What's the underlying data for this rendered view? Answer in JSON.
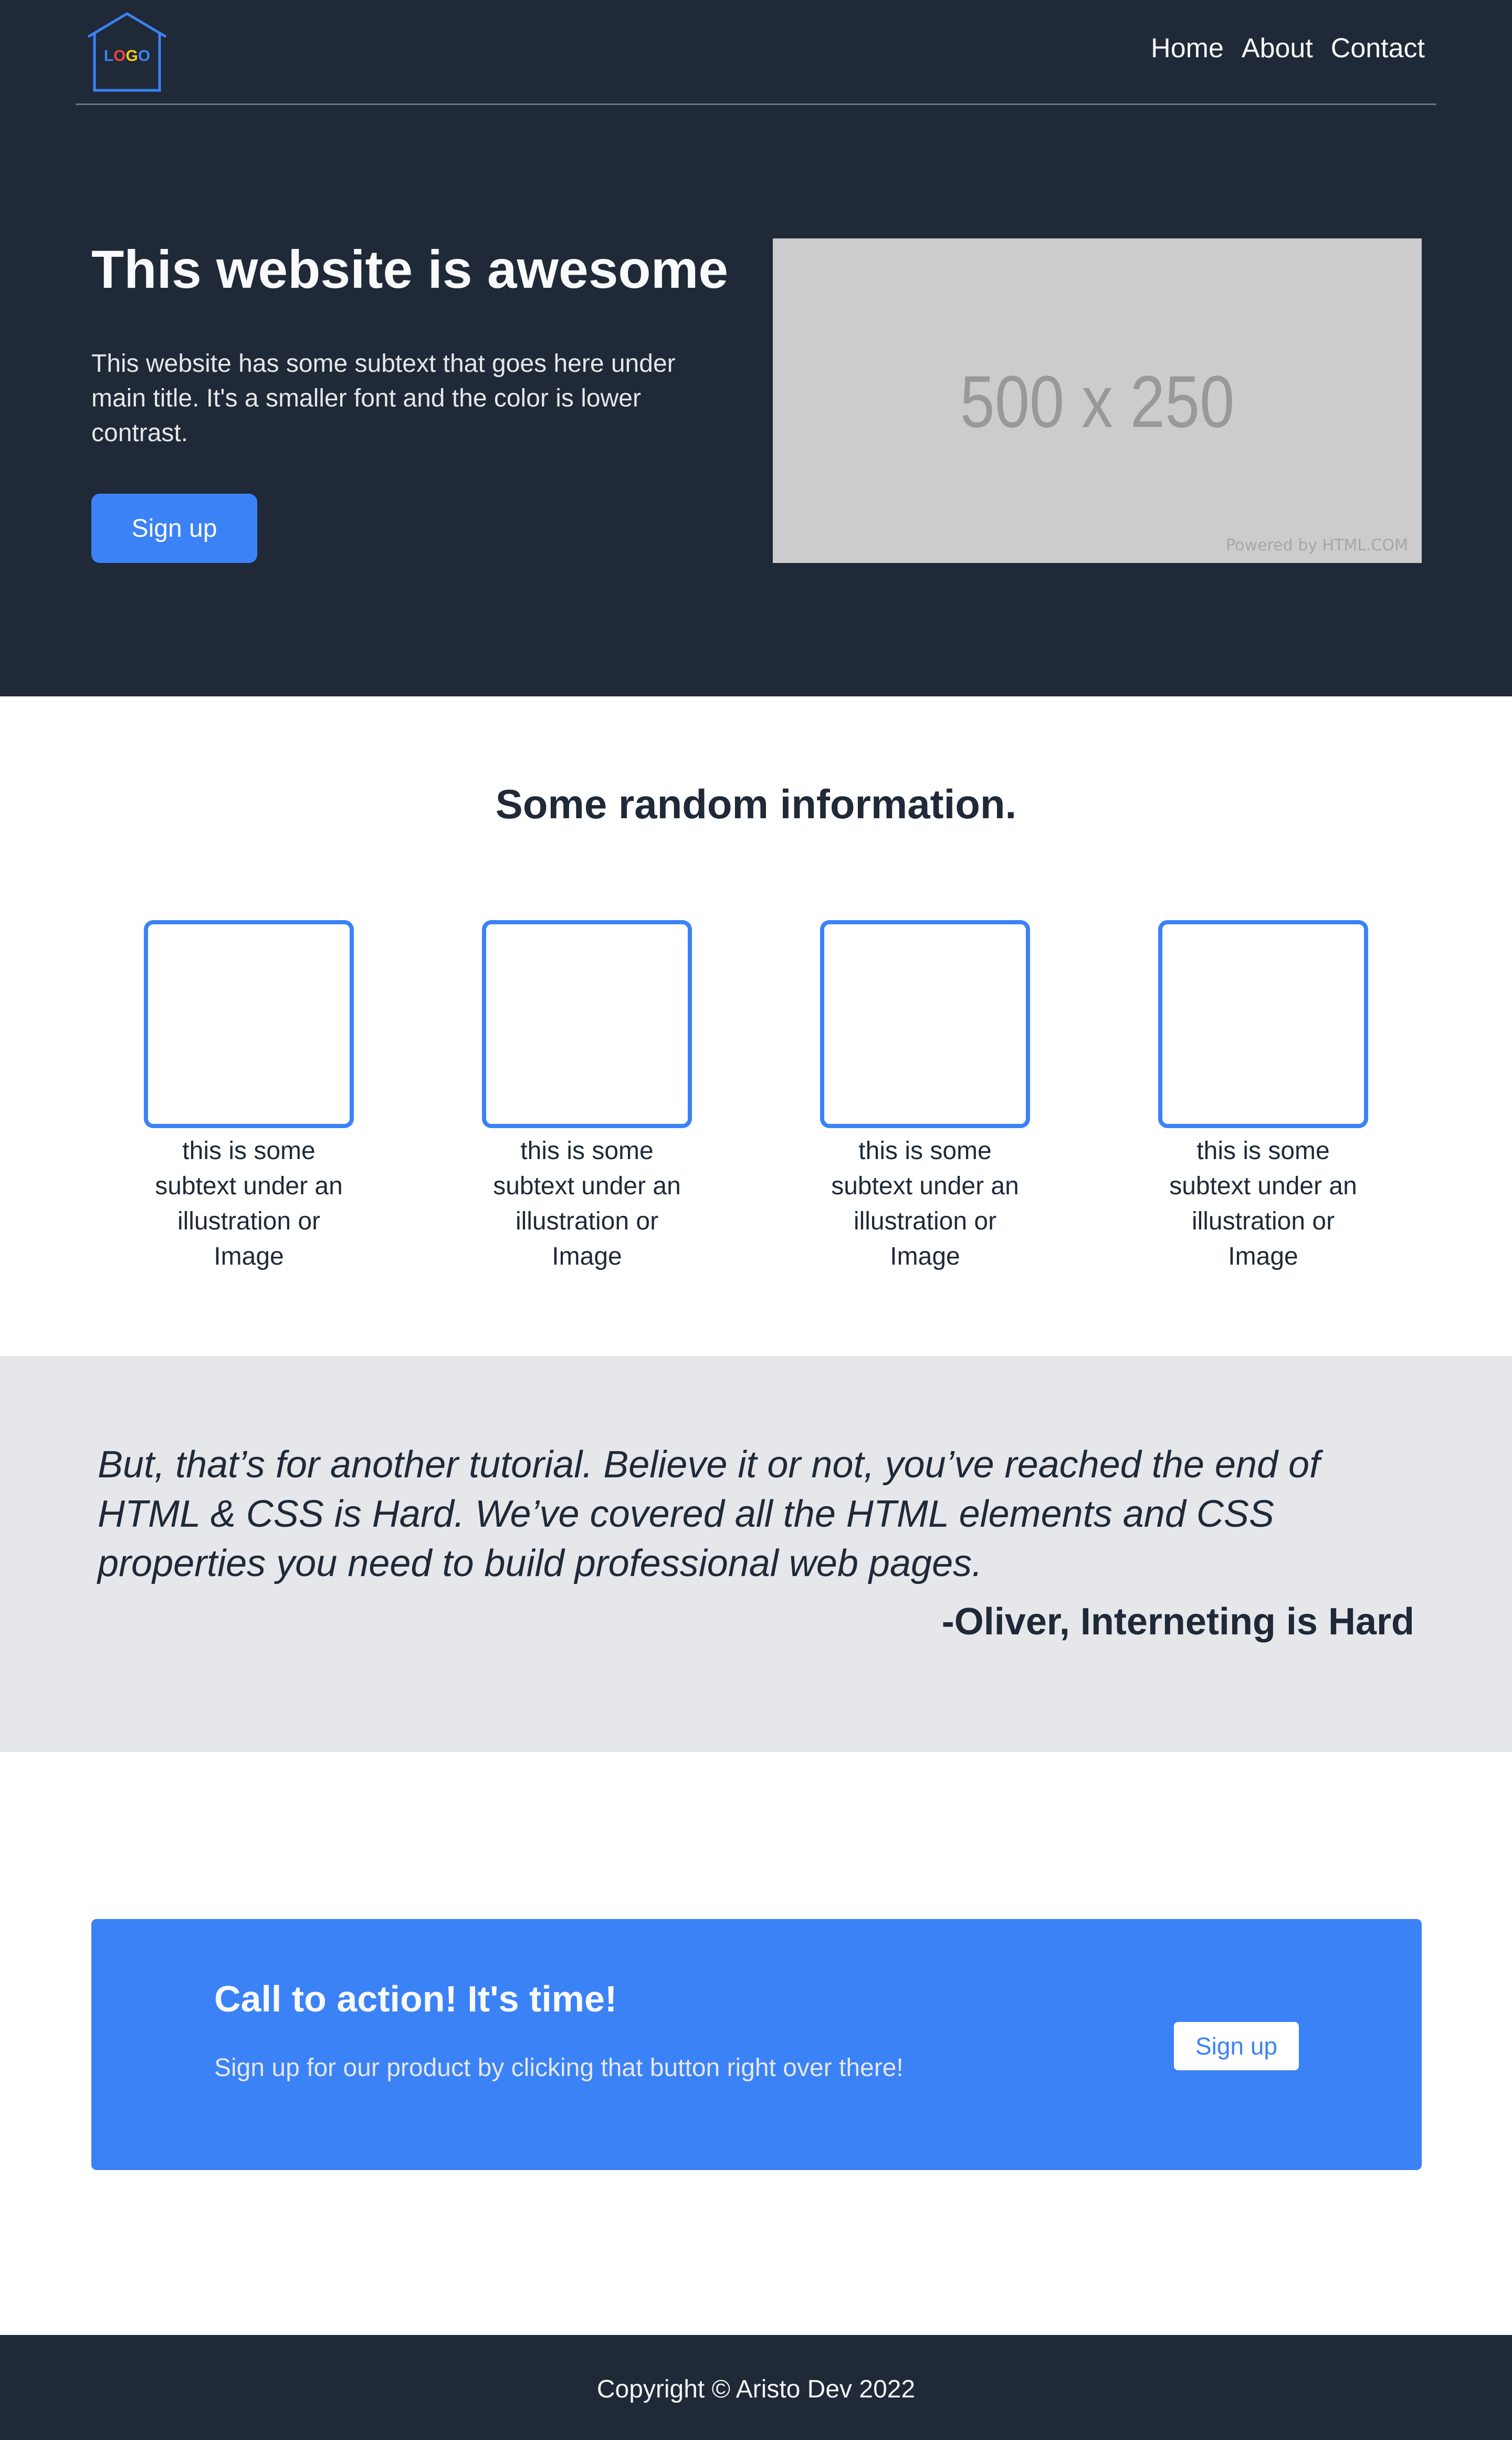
{
  "colors": {
    "dark": "#1f2937",
    "accent": "#3b82f6",
    "light_gray": "#e5e7eb",
    "white": "#ffffff",
    "placeholder": "#cccccc"
  },
  "header": {
    "logo": {
      "icon": "house-logo-icon",
      "letters": [
        "L",
        "O",
        "G",
        "O"
      ],
      "letter_colors": [
        "#3b82f6",
        "#ef4444",
        "#facc15",
        "#3b82f6"
      ]
    },
    "nav": [
      {
        "label": "Home"
      },
      {
        "label": "About"
      },
      {
        "label": "Contact"
      }
    ]
  },
  "hero": {
    "title": "This website is awesome",
    "subtext": "This website has some subtext that goes here under main title. It's a smaller font and the color is lower contrast.",
    "button_label": "Sign up",
    "image": {
      "label": "500 x 250",
      "powered_by": "Powered by HTML.COM"
    }
  },
  "info": {
    "heading": "Some random information.",
    "cards": [
      {
        "caption": "this is some subtext under an illustration or Image"
      },
      {
        "caption": "this is some subtext under an illustration or Image"
      },
      {
        "caption": "this is some subtext under an illustration or Image"
      },
      {
        "caption": "this is some subtext under an illustration or Image"
      }
    ]
  },
  "quote": {
    "text": "But, that’s for another tutorial. Believe it or not, you’ve reached the end of HTML & CSS is Hard. We’ve covered all the HTML elements and CSS properties you need to build professional web pages.",
    "author": "-Oliver, Interneting is Hard"
  },
  "cta": {
    "title": "Call to action! It's time!",
    "subtext": "Sign up for our product by clicking that button right over there!",
    "button_label": "Sign up"
  },
  "footer": {
    "copyright": "Copyright © Aristo Dev 2022"
  }
}
